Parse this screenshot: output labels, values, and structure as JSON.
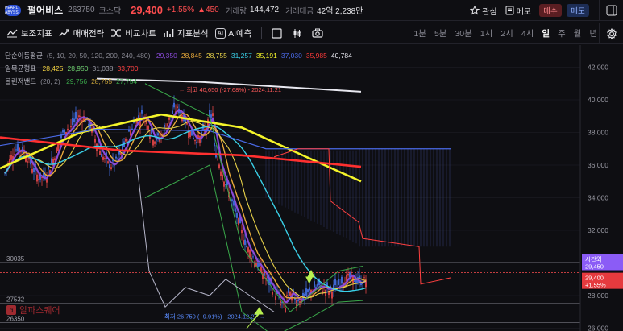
{
  "header": {
    "logo_text": "PEARL ABYSS",
    "stock_name": "펄어비스",
    "code": "263750",
    "market": "코스닥",
    "price": "29,400",
    "change_pct": "+1.55%",
    "change_abs": "▲450",
    "volume_label": "거래량",
    "volume": "144,472",
    "amount_label": "거래대금",
    "amount": "42억 2,238만",
    "watch_label": "관심",
    "memo_label": "메모",
    "buy_label": "매수",
    "sell_label": "매도"
  },
  "toolbar": {
    "aux_indicator": "보조지표",
    "trade_strategy": "매매전략",
    "compare_chart": "비교차트",
    "indicator_analysis": "지표분석",
    "ai_badge": "AI",
    "ai_predict": "AI예측",
    "periods": [
      "1분",
      "5분",
      "30분",
      "1시",
      "2시",
      "4시",
      "일",
      "주",
      "월",
      "년"
    ],
    "active_period": "일"
  },
  "legend": {
    "ma": {
      "label": "단순이동평균",
      "params": "(5, 10, 20, 50, 120, 200, 240, 480)",
      "values": [
        "29,350",
        "28,845",
        "28,755",
        "31,257",
        "35,191",
        "37,030",
        "35,985",
        "40,784"
      ],
      "colors": [
        "#8a4ad8",
        "#e8a93a",
        "#e8d24a",
        "#3ad0e8",
        "#f4f42a",
        "#4a6ae8",
        "#ff3a3a",
        "#e8e8f0"
      ]
    },
    "ichimoku": {
      "label": "일목균형표",
      "values": [
        "28,425",
        "28,950",
        "31,038",
        "33,700"
      ],
      "colors": [
        "#f0d040",
        "#6fd06f",
        "#9a9aa4",
        "#ff4040"
      ]
    },
    "bollinger": {
      "label": "볼린저밴드",
      "params": "(20, 2)",
      "values": [
        "29,756",
        "28,755",
        "27,754"
      ],
      "colors": [
        "#3aa84a",
        "#c9a43a",
        "#3aa84a"
      ]
    }
  },
  "annotations": {
    "high": "최고 40,650 (-27.68%) - 2024.11.21",
    "low": "최저 26,750 (+9.91%) - 2024.12.27",
    "level_1": "30035",
    "level_2": "27532",
    "level_3": "26350"
  },
  "price_axis": {
    "ticks": [
      "42,000",
      "40,000",
      "38,000",
      "36,000",
      "34,000",
      "32,000",
      "30,000",
      "28,000",
      "26,000"
    ],
    "after_hours_label": "시간외",
    "after_hours_price": "29,450",
    "current_price": "29,400",
    "current_change": "+1.55%"
  },
  "watermark": {
    "icon": "α",
    "text": "알파스퀘어"
  },
  "colors": {
    "up": "#ff4d4f",
    "down": "#4a7cff",
    "background": "#0e0e12",
    "after_hours": "#8b5cf6"
  },
  "icons": [
    "star-icon",
    "memo-icon",
    "panel-toggle-icon",
    "indicator-icon",
    "strategy-icon",
    "compare-icon",
    "analysis-icon",
    "drawing-box-icon",
    "candle-type-icon",
    "camera-icon",
    "gear-icon"
  ]
}
